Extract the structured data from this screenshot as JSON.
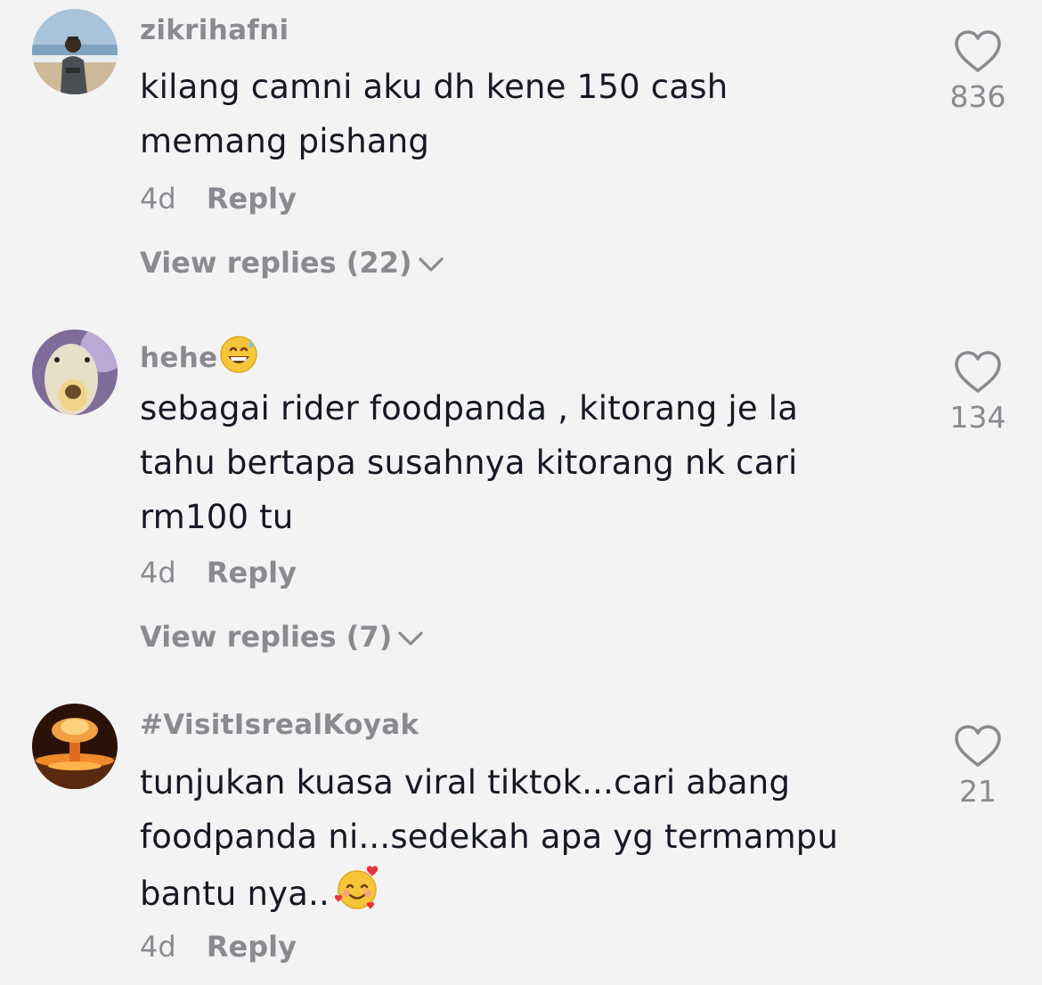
{
  "comments": [
    {
      "username": "zikrihafni",
      "text": "kilang camni aku dh kene 150 cash memang pishang",
      "time": "4d",
      "reply_label": "Reply",
      "view_replies": "View replies (22)",
      "likes": "836",
      "avatar_icon": "beach-person-avatar"
    },
    {
      "username": "hehe",
      "username_emoji": "grinning-sweat-emoji",
      "text": "sebagai rider foodpanda , kitorang je la tahu bertapa susahnya kitorang nk cari rm100 tu",
      "time": "4d",
      "reply_label": "Reply",
      "view_replies": "View replies (7)",
      "likes": "134",
      "avatar_icon": "duck-avatar"
    },
    {
      "username": "#VisitIsrealKoyak",
      "text": "tunjukan kuasa viral tiktok...cari abang foodpanda ni...sedekah apa yg termampu bantu nya..",
      "text_emoji": "smiling-face-with-hearts-emoji",
      "time": "4d",
      "reply_label": "Reply",
      "likes": "21",
      "avatar_icon": "explosion-avatar"
    }
  ],
  "colors": {
    "background": "#f3f3f3",
    "primary_text": "#161823",
    "secondary_text": "#8a8b91"
  }
}
